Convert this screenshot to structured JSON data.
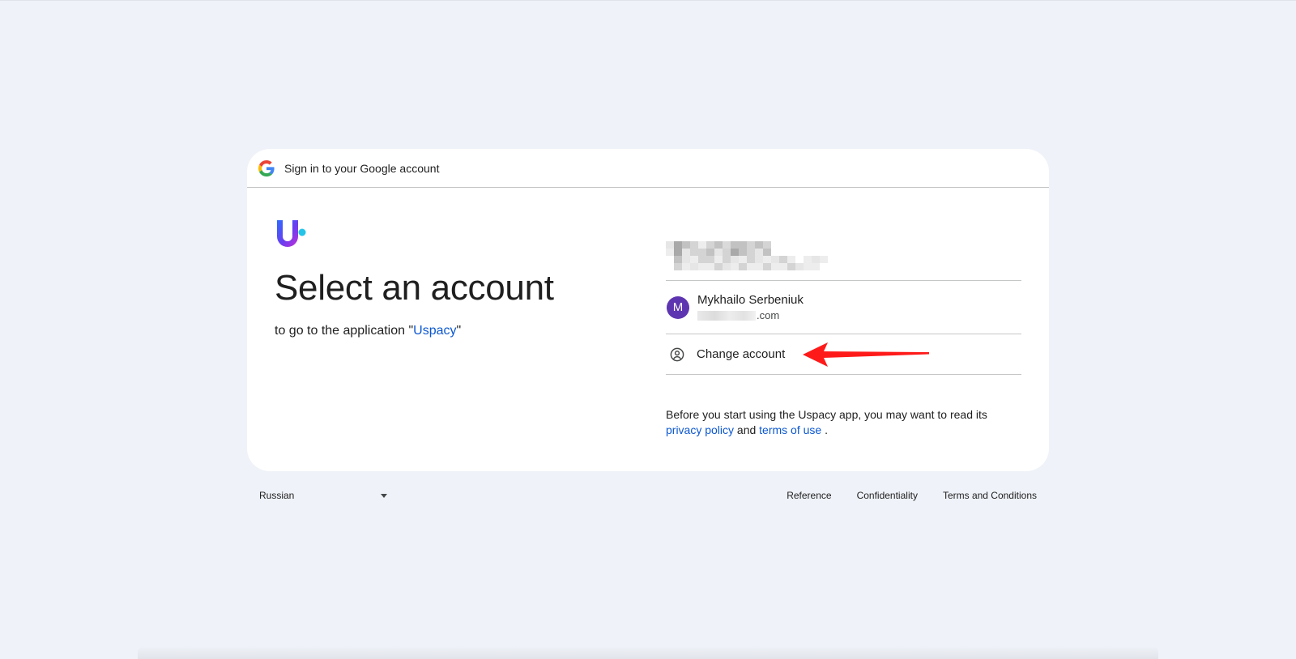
{
  "header": {
    "title": "Sign in to your Google account",
    "logo_icon": "google-g-icon"
  },
  "main": {
    "app_logo_icon": "uspacy-logo-icon",
    "title": "Select an account",
    "subtitle_prefix": "to go to the application \"",
    "app_name": "Uspacy",
    "subtitle_suffix": "\""
  },
  "accounts": [
    {
      "avatar_letter": "M",
      "avatar_color": "#5e35b1",
      "name": "Mykhailo Serbeniuk",
      "email_visible": ".com"
    }
  ],
  "change_account": {
    "label": "Change account",
    "icon": "account-circle-icon"
  },
  "annotation": {
    "arrow_color": "#ff1a1a"
  },
  "notice": {
    "text_before": "Before you start using the Uspacy app, you may want to read its ",
    "privacy_link": "privacy policy",
    "and": " and ",
    "terms_link": "terms of use",
    "text_after": " ."
  },
  "footer": {
    "language": "Russian",
    "links": [
      "Reference",
      "Confidentiality",
      "Terms and Conditions"
    ]
  },
  "colors": {
    "background": "#eff2f8",
    "link": "#0b57d0",
    "divider": "#c4c7c5"
  }
}
